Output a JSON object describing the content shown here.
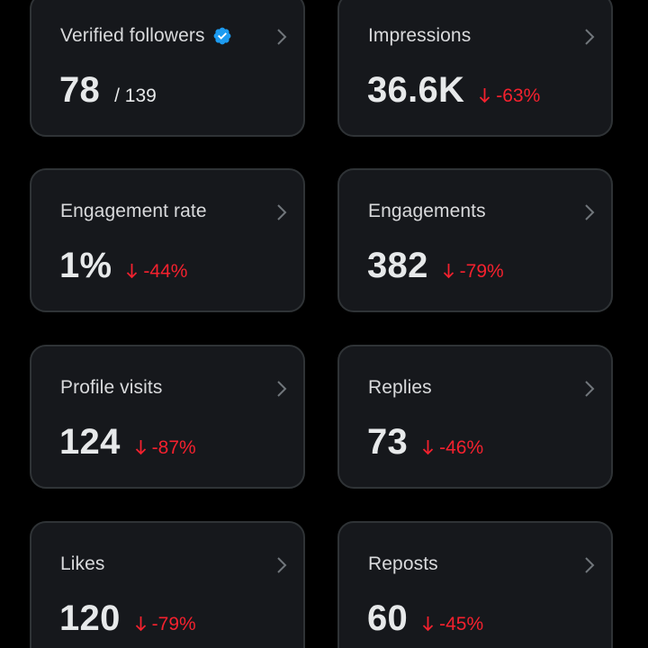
{
  "colors": {
    "background": "#000000",
    "card_bg": "#16181c",
    "card_border": "#2f3336",
    "negative": "#f4212e",
    "verified": "#1d9bf0"
  },
  "cards": [
    {
      "title": "Verified followers",
      "value": "78",
      "total": "/ 139",
      "change": "",
      "icon": "verified-badge-icon"
    },
    {
      "title": "Impressions",
      "value": "36.6K",
      "change": "-63%",
      "icon": "down-arrow-icon"
    },
    {
      "title": "Engagement rate",
      "value": "1%",
      "change": "-44%",
      "icon": "down-arrow-icon"
    },
    {
      "title": "Engagements",
      "value": "382",
      "change": "-79%",
      "icon": "down-arrow-icon"
    },
    {
      "title": "Profile visits",
      "value": "124",
      "change": "-87%",
      "icon": "down-arrow-icon"
    },
    {
      "title": "Replies",
      "value": "73",
      "change": "-46%",
      "icon": "down-arrow-icon"
    },
    {
      "title": "Likes",
      "value": "120",
      "change": "-79%",
      "icon": "down-arrow-icon"
    },
    {
      "title": "Reposts",
      "value": "60",
      "change": "-45%",
      "icon": "down-arrow-icon"
    }
  ]
}
